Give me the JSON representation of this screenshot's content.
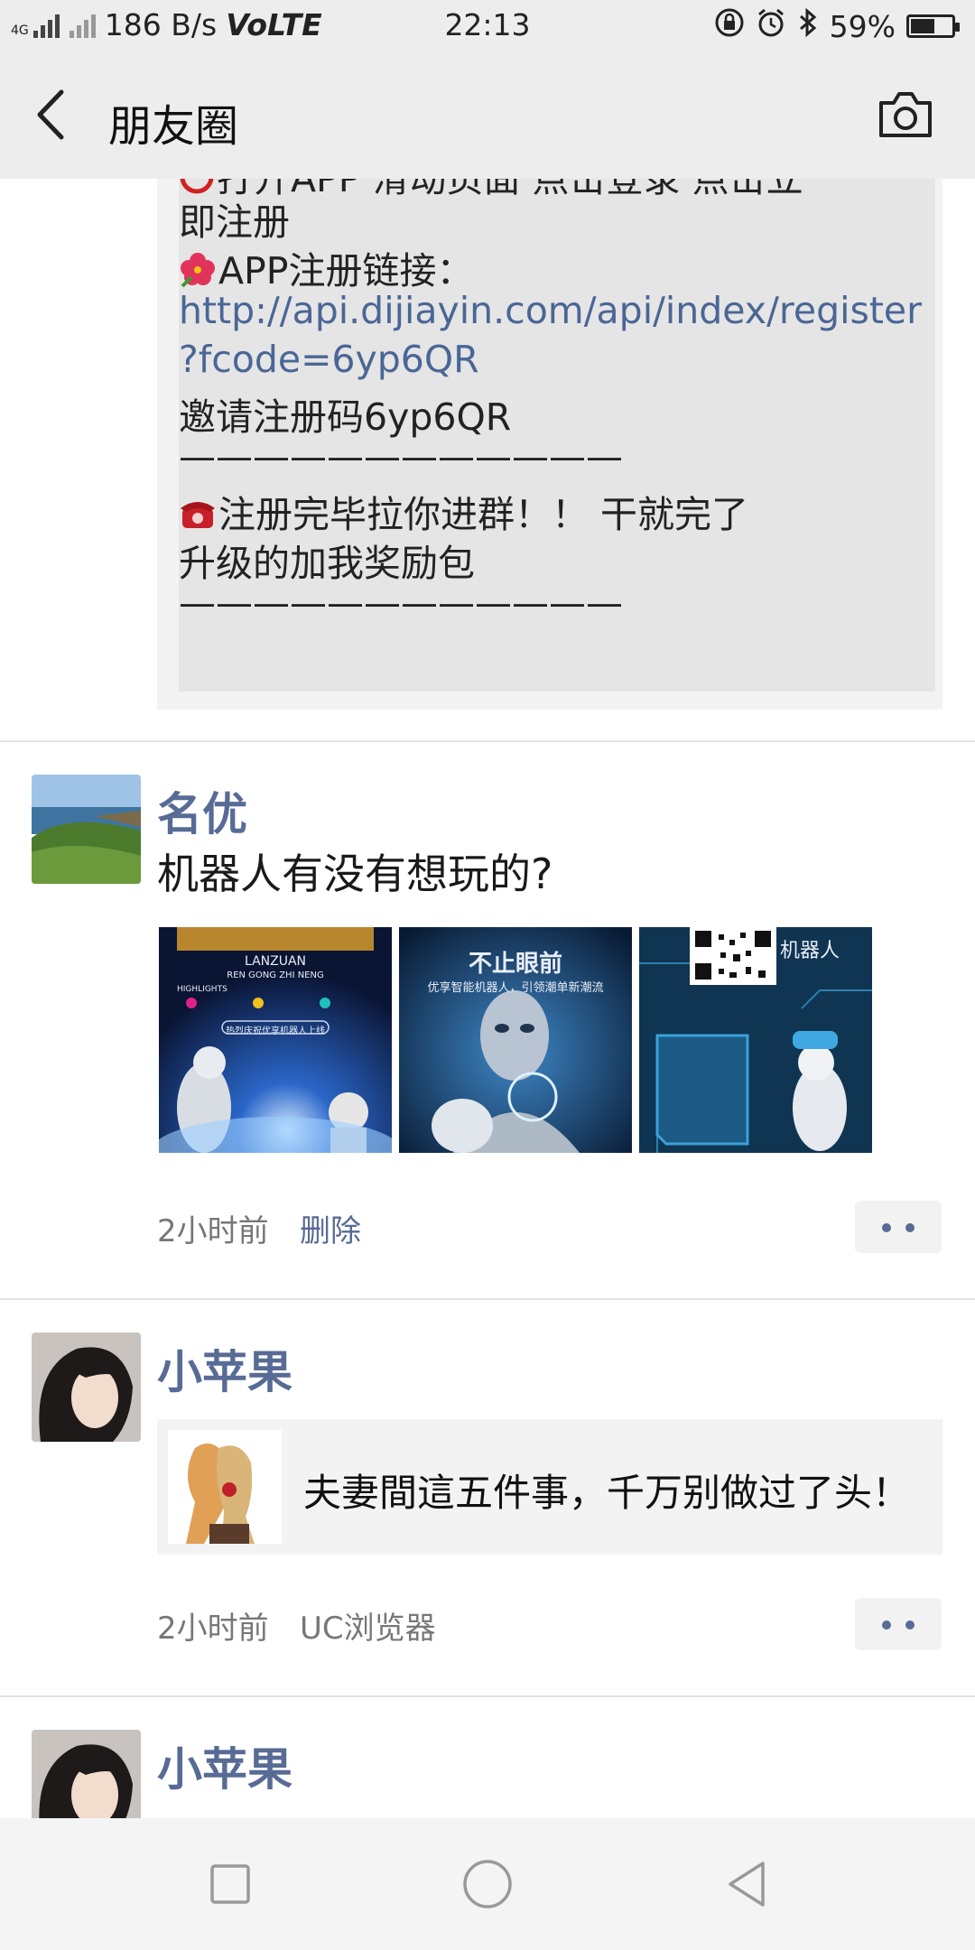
{
  "status_bar": {
    "network": "4G",
    "speed": "186 B/s",
    "volte": "VoLTE",
    "time": "22:13",
    "battery_percent": "59%",
    "battery_level": 0.59,
    "icons": [
      "signal-icon",
      "lock-rotation-icon",
      "alarm-icon",
      "bluetooth-icon",
      "battery-icon"
    ]
  },
  "header": {
    "title": "朋友圈",
    "back_icon": "chevron-left-icon",
    "camera_icon": "camera-icon"
  },
  "posts": [
    {
      "lines": {
        "partial": "打开APP 滑动页面 点击登录 点击立",
        "register_tail": "即注册",
        "link_label": "APP注册链接：",
        "link_1": "http://api.dijiayin.com/api/index/register",
        "link_2": "?fcode=6yp6QR",
        "invite": "邀请注册码6yp6QR",
        "sep_1": "————————————",
        "group": "注册完毕拉你进群！！ 干就完了",
        "upgrade": "升级的加我奖励包",
        "sep_2": "————————————"
      },
      "emojis": [
        "prohibited-icon",
        "hibiscus-icon",
        "telephone-icon"
      ]
    },
    {
      "user": "名优",
      "text": "机器人有没有想玩的?",
      "images": [
        {
          "alt": "robot-poster-1",
          "caption_top": "LANZUAN",
          "caption_mid": "REN GONG ZHI NENG",
          "caption_label": "HIGHLIGHTS",
          "caption_btn": "热烈庆祝优享机器人上线"
        },
        {
          "alt": "robot-poster-2",
          "caption_top": "不止眼前",
          "caption_mid": "优享智能机器人，引领潮单新潮流"
        },
        {
          "alt": "robot-poster-3",
          "caption_top": "机器人"
        }
      ],
      "time": "2小时前",
      "action": "删除"
    },
    {
      "user": "小苹果",
      "link_card": {
        "title": "夫妻間這五件事，千万别做过了头！"
      },
      "time": "2小时前",
      "source": "UC浏览器"
    },
    {
      "user": "小苹果"
    }
  ],
  "nav_bar": {
    "icons": [
      "recent-apps-icon",
      "home-icon",
      "back-icon"
    ]
  },
  "colors": {
    "link": "#576b95",
    "header_bg": "#ededed",
    "content_bg": "#f3f3f3"
  }
}
